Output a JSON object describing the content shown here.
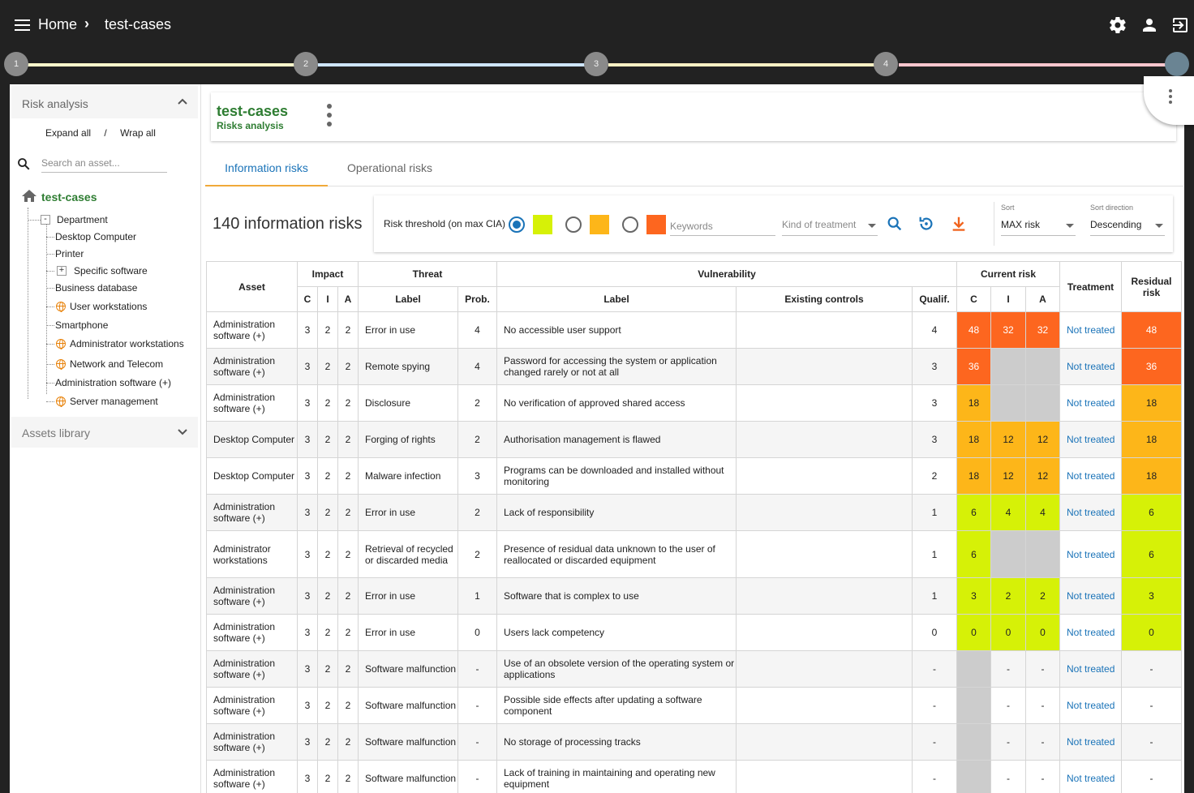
{
  "breadcrumb": {
    "home": "Home",
    "current": "test-cases"
  },
  "stepper": {
    "steps": [
      "1",
      "2",
      "3",
      "4"
    ],
    "line_colors": [
      "#fffbcc",
      "#cfe6ff",
      "#fdf1c4",
      "#ffc7cf"
    ]
  },
  "sidebar": {
    "panel_title": "Risk analysis",
    "expand_all": "Expand all",
    "separator": "/",
    "wrap_all": "Wrap all",
    "search_placeholder": "Search an asset...",
    "root": "test-cases",
    "tree": {
      "department": "Department",
      "desktop_computer": "Desktop Computer",
      "printer": "Printer",
      "specific_software": "Specific software",
      "business_database": "Business database",
      "user_workstations": "User workstations",
      "smartphone": "Smartphone",
      "administrator_workstations": "Administrator workstations",
      "network_telecom": "Network and Telecom",
      "administration_software": "Administration software (+)",
      "server_management": "Server management"
    },
    "assets_library": "Assets library"
  },
  "header": {
    "title": "test-cases",
    "subtitle": "Risks analysis"
  },
  "tabs": {
    "info": "Information risks",
    "op": "Operational risks"
  },
  "risks_count": "140 information risks",
  "filters": {
    "threshold_label": "Risk threshold (on max CIA)",
    "threshold_colors": [
      "#d6f107",
      "#fdb619",
      "#fd661f"
    ],
    "keywords_placeholder": "Keywords",
    "kind_placeholder": "Kind of treatment",
    "sort_label": "Sort",
    "sort_value": "MAX risk",
    "sort_dir_label": "Sort direction",
    "sort_dir_value": "Descending"
  },
  "table": {
    "headers": {
      "asset": "Asset",
      "impact": "Impact",
      "threat": "Threat",
      "vulnerability": "Vulnerability",
      "current_risk": "Current risk",
      "treatment": "Treatment",
      "residual_risk": "Residual risk",
      "c": "C",
      "i": "I",
      "a": "A",
      "label": "Label",
      "prob": "Prob.",
      "vlabel": "Label",
      "existing_controls": "Existing controls",
      "qualif": "Qualif.",
      "rc": "C",
      "ri": "I",
      "ra": "A"
    },
    "rows": [
      {
        "asset": "Administration software (+)",
        "c": "3",
        "i": "2",
        "a": "2",
        "threat": "Error in use",
        "prob": "4",
        "vuln": "No accessible user support",
        "controls": "",
        "qualif": "4",
        "rc": "48",
        "ri": "32",
        "ra": "32",
        "rcC": "red",
        "riC": "red",
        "raC": "red",
        "treatment": "Not treated",
        "residual": "48",
        "resC": "red"
      },
      {
        "asset": "Administration software (+)",
        "c": "3",
        "i": "2",
        "a": "2",
        "threat": "Remote spying",
        "prob": "4",
        "vuln": "Password for accessing the system or application changed rarely or not at all",
        "controls": "",
        "qualif": "3",
        "rc": "36",
        "ri": "",
        "ra": "",
        "rcC": "red",
        "riC": "grey",
        "raC": "grey",
        "treatment": "Not treated",
        "residual": "36",
        "resC": "red"
      },
      {
        "asset": "Administration software (+)",
        "c": "3",
        "i": "2",
        "a": "2",
        "threat": "Disclosure",
        "prob": "2",
        "vuln": "No verification of approved shared access",
        "controls": "",
        "qualif": "3",
        "rc": "18",
        "ri": "",
        "ra": "",
        "rcC": "orange",
        "riC": "grey",
        "raC": "grey",
        "treatment": "Not treated",
        "residual": "18",
        "resC": "orange"
      },
      {
        "asset": "Desktop Computer",
        "c": "3",
        "i": "2",
        "a": "2",
        "threat": "Forging of rights",
        "prob": "2",
        "vuln": "Authorisation management is flawed",
        "controls": "",
        "qualif": "3",
        "rc": "18",
        "ri": "12",
        "ra": "12",
        "rcC": "orange",
        "riC": "orange",
        "raC": "orange",
        "treatment": "Not treated",
        "residual": "18",
        "resC": "orange"
      },
      {
        "asset": "Desktop Computer",
        "c": "3",
        "i": "2",
        "a": "2",
        "threat": "Malware infection",
        "prob": "3",
        "vuln": "Programs can be downloaded and installed without monitoring",
        "controls": "",
        "qualif": "2",
        "rc": "18",
        "ri": "12",
        "ra": "12",
        "rcC": "orange",
        "riC": "orange",
        "raC": "orange",
        "treatment": "Not treated",
        "residual": "18",
        "resC": "orange"
      },
      {
        "asset": "Administration software (+)",
        "c": "3",
        "i": "2",
        "a": "2",
        "threat": "Error in use",
        "prob": "2",
        "vuln": "Lack of responsibility",
        "controls": "",
        "qualif": "1",
        "rc": "6",
        "ri": "4",
        "ra": "4",
        "rcC": "green",
        "riC": "green",
        "raC": "green",
        "treatment": "Not treated",
        "residual": "6",
        "resC": "green"
      },
      {
        "asset": "Administrator workstations",
        "c": "3",
        "i": "2",
        "a": "2",
        "threat": "Retrieval of recycled or discarded media",
        "prob": "2",
        "vuln": "Presence of residual data unknown to the user of reallocated or discarded equipment",
        "controls": "",
        "qualif": "1",
        "rc": "6",
        "ri": "",
        "ra": "",
        "rcC": "green",
        "riC": "grey",
        "raC": "grey",
        "treatment": "Not treated",
        "residual": "6",
        "resC": "green",
        "tall": true
      },
      {
        "asset": "Administration software (+)",
        "c": "3",
        "i": "2",
        "a": "2",
        "threat": "Error in use",
        "prob": "1",
        "vuln": "Software that is complex to use",
        "controls": "",
        "qualif": "1",
        "rc": "3",
        "ri": "2",
        "ra": "2",
        "rcC": "green",
        "riC": "green",
        "raC": "green",
        "treatment": "Not treated",
        "residual": "3",
        "resC": "green"
      },
      {
        "asset": "Administration software (+)",
        "c": "3",
        "i": "2",
        "a": "2",
        "threat": "Error in use",
        "prob": "0",
        "vuln": "Users lack competency",
        "controls": "",
        "qualif": "0",
        "rc": "0",
        "ri": "0",
        "ra": "0",
        "rcC": "green",
        "riC": "green",
        "raC": "green",
        "treatment": "Not treated",
        "residual": "0",
        "resC": "green"
      },
      {
        "asset": "Administration software (+)",
        "c": "3",
        "i": "2",
        "a": "2",
        "threat": "Software malfunction",
        "prob": "-",
        "vuln": "Use of an obsolete version of the operating system or applications",
        "controls": "",
        "qualif": "-",
        "rc": "",
        "ri": "-",
        "ra": "-",
        "rcC": "grey",
        "riC": "",
        "raC": "",
        "treatment": "Not treated",
        "residual": "-",
        "resC": ""
      },
      {
        "asset": "Administration software (+)",
        "c": "3",
        "i": "2",
        "a": "2",
        "threat": "Software malfunction",
        "prob": "-",
        "vuln": "Possible side effects after updating a software component",
        "controls": "",
        "qualif": "-",
        "rc": "",
        "ri": "-",
        "ra": "-",
        "rcC": "grey",
        "riC": "",
        "raC": "",
        "treatment": "Not treated",
        "residual": "-",
        "resC": ""
      },
      {
        "asset": "Administration software (+)",
        "c": "3",
        "i": "2",
        "a": "2",
        "threat": "Software malfunction",
        "prob": "-",
        "vuln": "No storage of processing tracks",
        "controls": "",
        "qualif": "-",
        "rc": "",
        "ri": "-",
        "ra": "-",
        "rcC": "grey",
        "riC": "",
        "raC": "",
        "treatment": "Not treated",
        "residual": "-",
        "resC": ""
      },
      {
        "asset": "Administration software (+)",
        "c": "3",
        "i": "2",
        "a": "2",
        "threat": "Software malfunction",
        "prob": "-",
        "vuln": "Lack of training in maintaining and operating new equipment",
        "controls": "",
        "qualif": "-",
        "rc": "",
        "ri": "-",
        "ra": "-",
        "rcC": "grey",
        "riC": "",
        "raC": "",
        "treatment": "Not treated",
        "residual": "-",
        "resC": ""
      }
    ]
  }
}
